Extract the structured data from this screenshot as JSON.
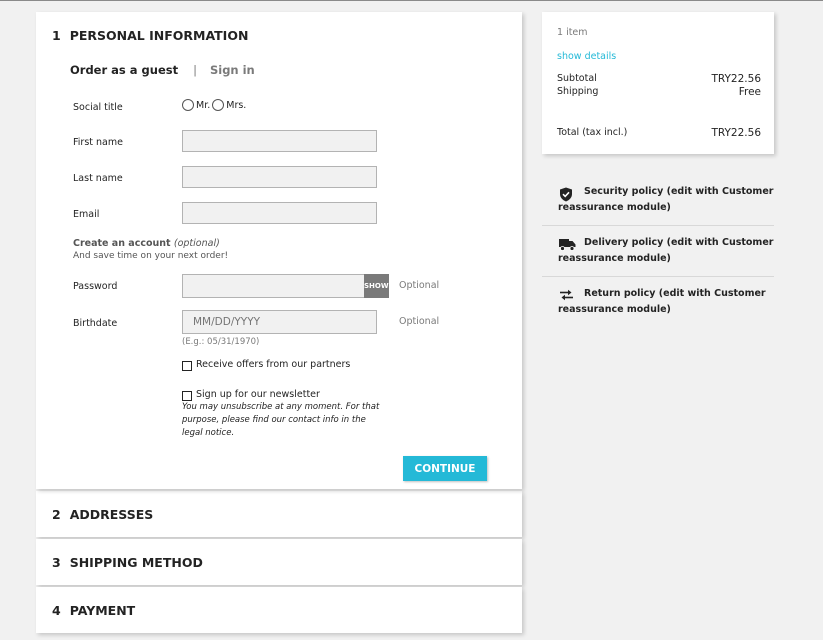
{
  "steps": [
    {
      "num": "1",
      "title": "PERSONAL INFORMATION"
    },
    {
      "num": "2",
      "title": "ADDRESSES"
    },
    {
      "num": "3",
      "title": "SHIPPING METHOD"
    },
    {
      "num": "4",
      "title": "PAYMENT"
    }
  ],
  "personal": {
    "tab_guest": "Order as a guest",
    "tab_separator": "|",
    "tab_signin": "Sign in",
    "social_title_label": "Social title",
    "mr_label": "Mr.",
    "mrs_label": "Mrs.",
    "first_name_label": "First name",
    "first_name_value": "",
    "last_name_label": "Last name",
    "last_name_value": "",
    "email_label": "Email",
    "email_value": "",
    "create_account_title": "Create an account",
    "create_account_optional": "(optional)",
    "create_account_sub": "And save time on your next order!",
    "password_label": "Password",
    "password_value": "",
    "show_label": "SHOW",
    "optional_label": "Optional",
    "birthdate_label": "Birthdate",
    "birthdate_placeholder": "MM/DD/YYYY",
    "birthdate_hint": "(E.g.: 05/31/1970)",
    "partners_label": "Receive offers from our partners",
    "newsletter_label": "Sign up for our newsletter",
    "newsletter_note": "You may unsubscribe at any moment. For that purpose, please find our contact info in the legal notice.",
    "continue_label": "CONTINUE"
  },
  "summary": {
    "items_count": "1 item",
    "show_details": "show details",
    "subtotal_label": "Subtotal",
    "subtotal_value": "TRY22.56",
    "shipping_label": "Shipping",
    "shipping_value": "Free",
    "total_label": "Total (tax incl.)",
    "total_value": "TRY22.56"
  },
  "reassurance": [
    {
      "icon": "shield-check-icon",
      "text": "Security policy (edit with Customer reassurance module)"
    },
    {
      "icon": "truck-icon",
      "text": "Delivery policy (edit with Customer reassurance module)"
    },
    {
      "icon": "swap-arrows-icon",
      "text": "Return policy (edit with Customer reassurance module)"
    }
  ],
  "colors": {
    "accent": "#24b9d7",
    "background": "#f1f1f1",
    "text": "#232323",
    "muted": "#7a7a7a"
  }
}
